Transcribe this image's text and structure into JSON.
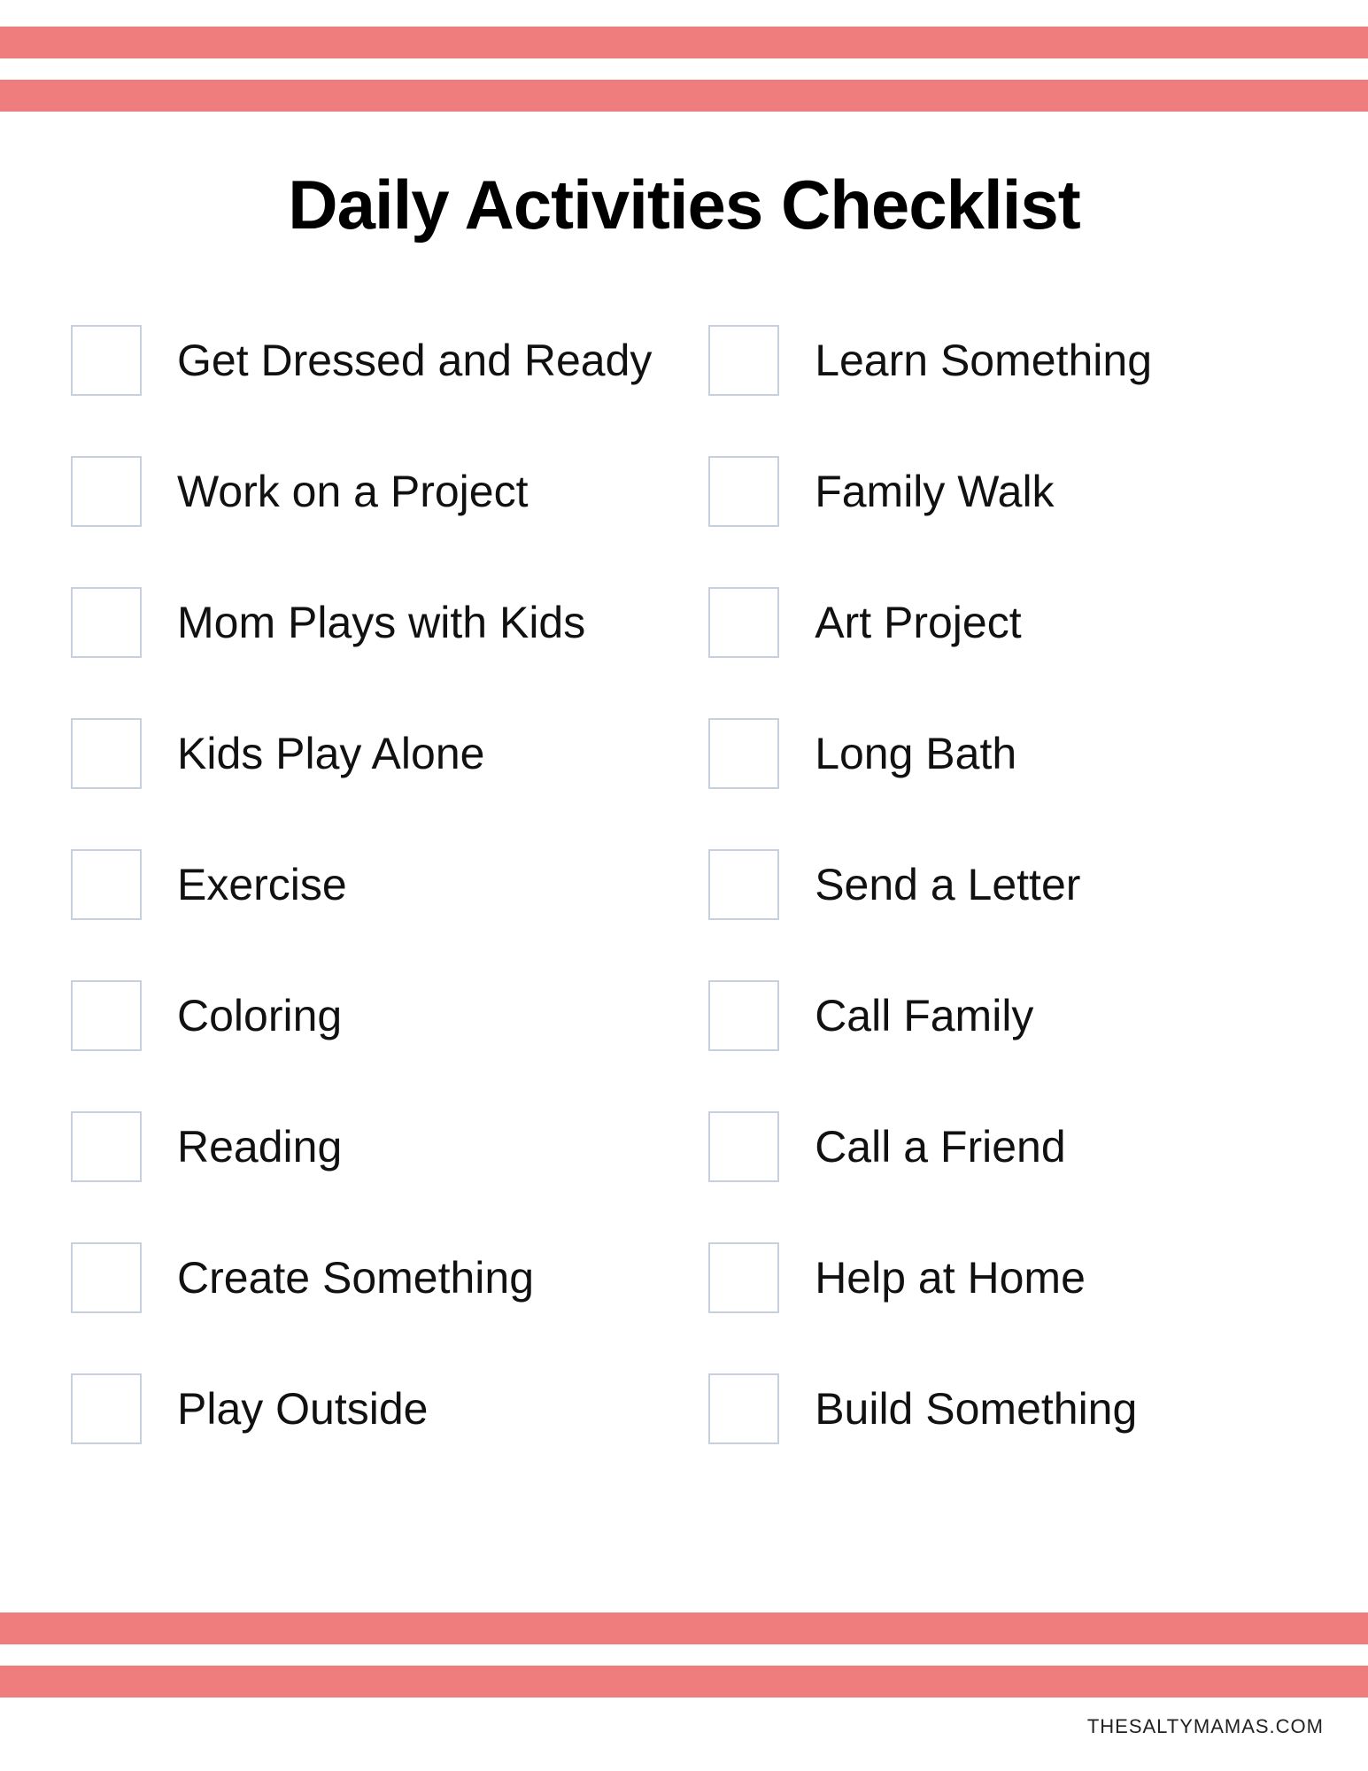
{
  "title": "Daily Activities Checklist",
  "columns": {
    "left": [
      "Get Dressed and Ready",
      "Work on a Project",
      "Mom Plays with Kids",
      "Kids Play Alone",
      "Exercise",
      "Coloring",
      "Reading",
      "Create Something",
      "Play Outside"
    ],
    "right": [
      "Learn Something",
      "Family Walk",
      "Art Project",
      "Long Bath",
      "Send a Letter",
      "Call Family",
      "Call a Friend",
      "Help at Home",
      "Build Something"
    ]
  },
  "footer": "THESALTYMAMAS.COM",
  "colors": {
    "stripe": "#ef7d7d",
    "checkbox_border": "#c8cfdd"
  }
}
